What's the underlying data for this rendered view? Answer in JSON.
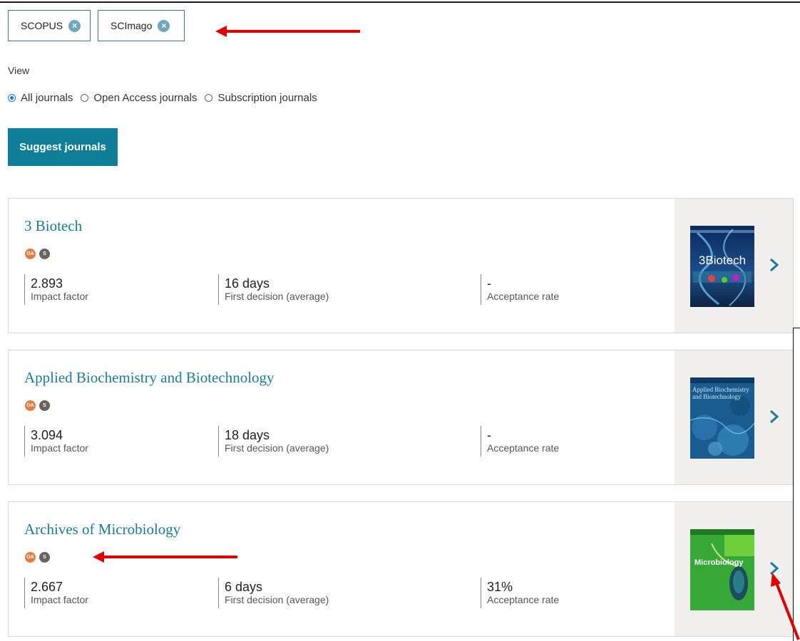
{
  "filters": {
    "chips": [
      {
        "label": "SCOPUS"
      },
      {
        "label": "SCImago"
      }
    ],
    "remove_glyph": "×"
  },
  "view": {
    "label": "View",
    "options": [
      {
        "label": "All journals",
        "checked": true
      },
      {
        "label": "Open Access journals",
        "checked": false
      },
      {
        "label": "Subscription journals",
        "checked": false
      }
    ]
  },
  "suggest_button": {
    "label": "Suggest journals"
  },
  "journals": [
    {
      "title": "3 Biotech",
      "badges": [
        "OA",
        "S"
      ],
      "impact_factor": "2.893",
      "impact_factor_label": "Impact factor",
      "first_decision": "16 days",
      "first_decision_label": "First decision (average)",
      "acceptance_rate": "-",
      "acceptance_rate_label": "Acceptance rate",
      "cover_text": "3Biotech"
    },
    {
      "title": "Applied Biochemistry and Biotechnology",
      "badges": [
        "OA",
        "S"
      ],
      "impact_factor": "3.094",
      "impact_factor_label": "Impact factor",
      "first_decision": "18 days",
      "first_decision_label": "First decision (average)",
      "acceptance_rate": "-",
      "acceptance_rate_label": "Acceptance rate",
      "cover_text": "Applied Biochemistry and Biotechnology"
    },
    {
      "title": "Archives of Microbiology",
      "badges": [
        "OA",
        "S"
      ],
      "impact_factor": "2.667",
      "impact_factor_label": "Impact factor",
      "first_decision": "6 days",
      "first_decision_label": "First decision (average)",
      "acceptance_rate": "31%",
      "acceptance_rate_label": "Acceptance rate",
      "cover_text": "Microbiology"
    }
  ],
  "colors": {
    "accent": "#1b7b93",
    "button": "#0f7f97",
    "badge_oa": "#e27d45",
    "badge_s": "#6a625c",
    "annotation_arrow": "#e00000"
  },
  "icons": {
    "chevron": "chevron-right-icon",
    "remove": "close-circle-icon"
  }
}
